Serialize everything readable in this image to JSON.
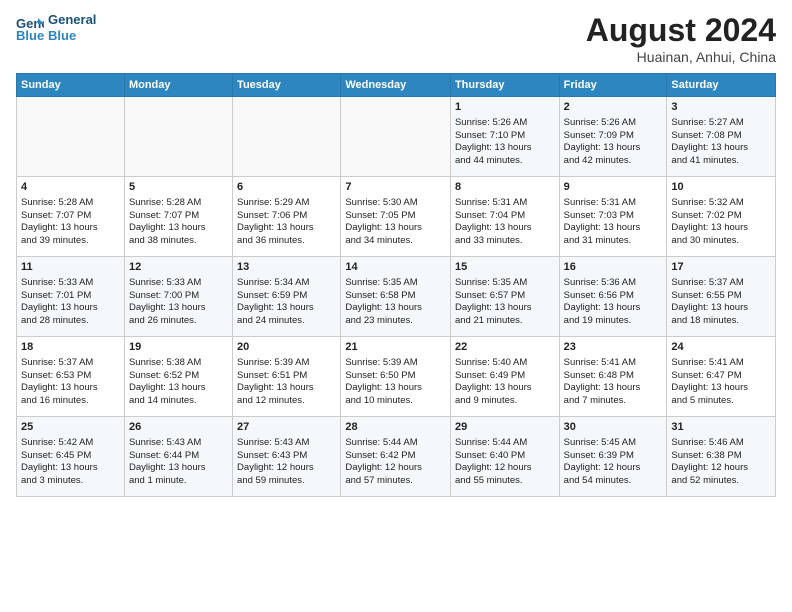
{
  "header": {
    "logo_line1": "General",
    "logo_line2": "Blue",
    "title": "August 2024",
    "subtitle": "Huainan, Anhui, China"
  },
  "days_of_week": [
    "Sunday",
    "Monday",
    "Tuesday",
    "Wednesday",
    "Thursday",
    "Friday",
    "Saturday"
  ],
  "weeks": [
    [
      {
        "day": "",
        "content": ""
      },
      {
        "day": "",
        "content": ""
      },
      {
        "day": "",
        "content": ""
      },
      {
        "day": "",
        "content": ""
      },
      {
        "day": "1",
        "content": "Sunrise: 5:26 AM\nSunset: 7:10 PM\nDaylight: 13 hours\nand 44 minutes."
      },
      {
        "day": "2",
        "content": "Sunrise: 5:26 AM\nSunset: 7:09 PM\nDaylight: 13 hours\nand 42 minutes."
      },
      {
        "day": "3",
        "content": "Sunrise: 5:27 AM\nSunset: 7:08 PM\nDaylight: 13 hours\nand 41 minutes."
      }
    ],
    [
      {
        "day": "4",
        "content": "Sunrise: 5:28 AM\nSunset: 7:07 PM\nDaylight: 13 hours\nand 39 minutes."
      },
      {
        "day": "5",
        "content": "Sunrise: 5:28 AM\nSunset: 7:07 PM\nDaylight: 13 hours\nand 38 minutes."
      },
      {
        "day": "6",
        "content": "Sunrise: 5:29 AM\nSunset: 7:06 PM\nDaylight: 13 hours\nand 36 minutes."
      },
      {
        "day": "7",
        "content": "Sunrise: 5:30 AM\nSunset: 7:05 PM\nDaylight: 13 hours\nand 34 minutes."
      },
      {
        "day": "8",
        "content": "Sunrise: 5:31 AM\nSunset: 7:04 PM\nDaylight: 13 hours\nand 33 minutes."
      },
      {
        "day": "9",
        "content": "Sunrise: 5:31 AM\nSunset: 7:03 PM\nDaylight: 13 hours\nand 31 minutes."
      },
      {
        "day": "10",
        "content": "Sunrise: 5:32 AM\nSunset: 7:02 PM\nDaylight: 13 hours\nand 30 minutes."
      }
    ],
    [
      {
        "day": "11",
        "content": "Sunrise: 5:33 AM\nSunset: 7:01 PM\nDaylight: 13 hours\nand 28 minutes."
      },
      {
        "day": "12",
        "content": "Sunrise: 5:33 AM\nSunset: 7:00 PM\nDaylight: 13 hours\nand 26 minutes."
      },
      {
        "day": "13",
        "content": "Sunrise: 5:34 AM\nSunset: 6:59 PM\nDaylight: 13 hours\nand 24 minutes."
      },
      {
        "day": "14",
        "content": "Sunrise: 5:35 AM\nSunset: 6:58 PM\nDaylight: 13 hours\nand 23 minutes."
      },
      {
        "day": "15",
        "content": "Sunrise: 5:35 AM\nSunset: 6:57 PM\nDaylight: 13 hours\nand 21 minutes."
      },
      {
        "day": "16",
        "content": "Sunrise: 5:36 AM\nSunset: 6:56 PM\nDaylight: 13 hours\nand 19 minutes."
      },
      {
        "day": "17",
        "content": "Sunrise: 5:37 AM\nSunset: 6:55 PM\nDaylight: 13 hours\nand 18 minutes."
      }
    ],
    [
      {
        "day": "18",
        "content": "Sunrise: 5:37 AM\nSunset: 6:53 PM\nDaylight: 13 hours\nand 16 minutes."
      },
      {
        "day": "19",
        "content": "Sunrise: 5:38 AM\nSunset: 6:52 PM\nDaylight: 13 hours\nand 14 minutes."
      },
      {
        "day": "20",
        "content": "Sunrise: 5:39 AM\nSunset: 6:51 PM\nDaylight: 13 hours\nand 12 minutes."
      },
      {
        "day": "21",
        "content": "Sunrise: 5:39 AM\nSunset: 6:50 PM\nDaylight: 13 hours\nand 10 minutes."
      },
      {
        "day": "22",
        "content": "Sunrise: 5:40 AM\nSunset: 6:49 PM\nDaylight: 13 hours\nand 9 minutes."
      },
      {
        "day": "23",
        "content": "Sunrise: 5:41 AM\nSunset: 6:48 PM\nDaylight: 13 hours\nand 7 minutes."
      },
      {
        "day": "24",
        "content": "Sunrise: 5:41 AM\nSunset: 6:47 PM\nDaylight: 13 hours\nand 5 minutes."
      }
    ],
    [
      {
        "day": "25",
        "content": "Sunrise: 5:42 AM\nSunset: 6:45 PM\nDaylight: 13 hours\nand 3 minutes."
      },
      {
        "day": "26",
        "content": "Sunrise: 5:43 AM\nSunset: 6:44 PM\nDaylight: 13 hours\nand 1 minute."
      },
      {
        "day": "27",
        "content": "Sunrise: 5:43 AM\nSunset: 6:43 PM\nDaylight: 12 hours\nand 59 minutes."
      },
      {
        "day": "28",
        "content": "Sunrise: 5:44 AM\nSunset: 6:42 PM\nDaylight: 12 hours\nand 57 minutes."
      },
      {
        "day": "29",
        "content": "Sunrise: 5:44 AM\nSunset: 6:40 PM\nDaylight: 12 hours\nand 55 minutes."
      },
      {
        "day": "30",
        "content": "Sunrise: 5:45 AM\nSunset: 6:39 PM\nDaylight: 12 hours\nand 54 minutes."
      },
      {
        "day": "31",
        "content": "Sunrise: 5:46 AM\nSunset: 6:38 PM\nDaylight: 12 hours\nand 52 minutes."
      }
    ]
  ]
}
